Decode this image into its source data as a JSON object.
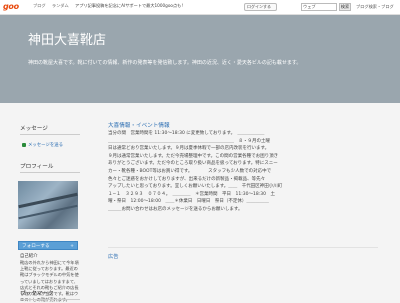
{
  "topbar": {
    "logo": "goo",
    "nav": [
      "ブログ",
      "ランダム",
      "アプリ記事投稿を記念にAIサポートで最大1000goo点も!"
    ],
    "login": "ログインする",
    "search_scope": "ウェブ",
    "search_button": "検索",
    "blog_link": "ブログ検索・ブログ"
  },
  "header": {
    "title": "神田大喜靴店",
    "description": "神田の靴屋大喜です。靴に付いての情報、新作の発表等を発信致します。神田の近況、近く・愛天各ビルの記も載せます。"
  },
  "sidebar": {
    "message_heading": "メッセージ",
    "message_link": "メッセージを送る",
    "profile_heading": "プロフィール",
    "follow_label": "フォローする",
    "follow_plus": "+",
    "profile_name": "自己紹介",
    "profile_text": "靴店の外れから神田にて今年頃上靴に従っております。最近の靴はブラックモデルの中気を使っていましてはおりますまて、店式とそれの靴もご紹介の店長も取り組みが当店です。靴はウエストしの靴が売れます。",
    "bookmark_heading": "ブックマーク"
  },
  "main": {
    "heading": "大喜情報・イベント情報",
    "lines": [
      "当分の間　営業時間を 11:30〜18:30 に変更致しております。　＿＿＿＿＿＿",
      "＿＿＿＿＿＿＿＿＿＿＿＿＿＿＿＿＿＿＿＿＿＿＿＿＿＿＿＿　８・９月の土曜",
      "日は通常どおり営業いたします。９月は夏季休暇で一部の店内改装を行います。",
      "９月は通常営業いたします。ただ今売場整理中です。この間の営業各種でお困り頂き",
      "ありがとうございます。ただ今のところ取り扱い商品を扱っております。特にスニー",
      "カー・靴各種・BOOT等はお買い得です。　　　　スタッフも少人数での対応中で",
      "色々とご迷惑をおかけしておりますが、出来るだけの新製品・掲載品、等先々",
      "アップしたいと思っております。宜しくお願いいたします。＿＿　千代田区神田小川町",
      "１−１　３２９３　０７０４。　＿＿＿＿　＊営業時間　平日　11:30〜18:30　土",
      "曜・祭日　12:00〜18:00　＿＿＊休業日　日曜日　祭日（不定休）＿＿＿＿＿",
      "＿＿＿お問い合わせはお店のメッセージを送るからお願いします。"
    ],
    "ad_label": "広告"
  }
}
